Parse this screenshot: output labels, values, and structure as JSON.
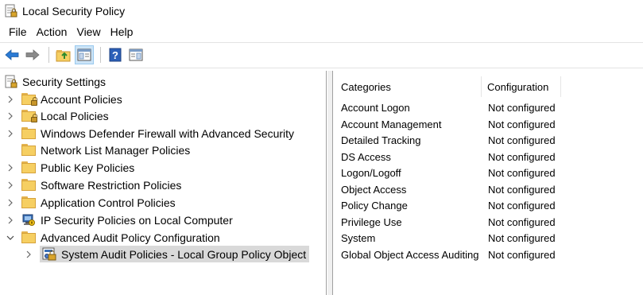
{
  "window": {
    "title": "Local Security Policy",
    "icon": "security-policy-icon"
  },
  "menu": [
    "File",
    "Action",
    "View",
    "Help"
  ],
  "toolbar": [
    {
      "name": "back-icon",
      "active": false
    },
    {
      "name": "forward-icon",
      "active": false
    },
    {
      "name": "up-folder-icon",
      "active": false
    },
    {
      "name": "show-hide-console-tree-icon",
      "active": true
    },
    {
      "name": "help-icon",
      "active": false
    },
    {
      "name": "show-hide-action-pane-icon",
      "active": false
    }
  ],
  "tree": {
    "root": "Security Settings",
    "items": [
      {
        "label": "Account Policies",
        "expander": "collapsed",
        "icon": "locked-folder-icon"
      },
      {
        "label": "Local Policies",
        "expander": "collapsed",
        "icon": "locked-folder-icon"
      },
      {
        "label": "Windows Defender Firewall with Advanced Security",
        "expander": "collapsed",
        "icon": "folder-icon"
      },
      {
        "label": "Network List Manager Policies",
        "expander": "none",
        "icon": "folder-icon"
      },
      {
        "label": "Public Key Policies",
        "expander": "collapsed",
        "icon": "folder-icon"
      },
      {
        "label": "Software Restriction Policies",
        "expander": "collapsed",
        "icon": "folder-icon"
      },
      {
        "label": "Application Control Policies",
        "expander": "collapsed",
        "icon": "folder-icon"
      },
      {
        "label": "IP Security Policies on Local Computer",
        "expander": "collapsed",
        "icon": "ip-security-icon"
      },
      {
        "label": "Advanced Audit Policy Configuration",
        "expander": "expanded",
        "icon": "folder-icon"
      }
    ],
    "child": {
      "label": "System Audit Policies - Local Group Policy Object",
      "expander": "collapsed",
      "icon": "group-policy-icon",
      "selected": true
    }
  },
  "list": {
    "columns": [
      "Categories",
      "Configuration"
    ],
    "rows": [
      {
        "category": "Account Logon",
        "configuration": "Not configured"
      },
      {
        "category": "Account Management",
        "configuration": "Not configured"
      },
      {
        "category": "Detailed Tracking",
        "configuration": "Not configured"
      },
      {
        "category": "DS Access",
        "configuration": "Not configured"
      },
      {
        "category": "Logon/Logoff",
        "configuration": "Not configured"
      },
      {
        "category": "Object Access",
        "configuration": "Not configured"
      },
      {
        "category": "Policy Change",
        "configuration": "Not configured"
      },
      {
        "category": "Privilege Use",
        "configuration": "Not configured"
      },
      {
        "category": "System",
        "configuration": "Not configured"
      },
      {
        "category": "Global Object Access Auditing",
        "configuration": "Not configured"
      }
    ]
  }
}
